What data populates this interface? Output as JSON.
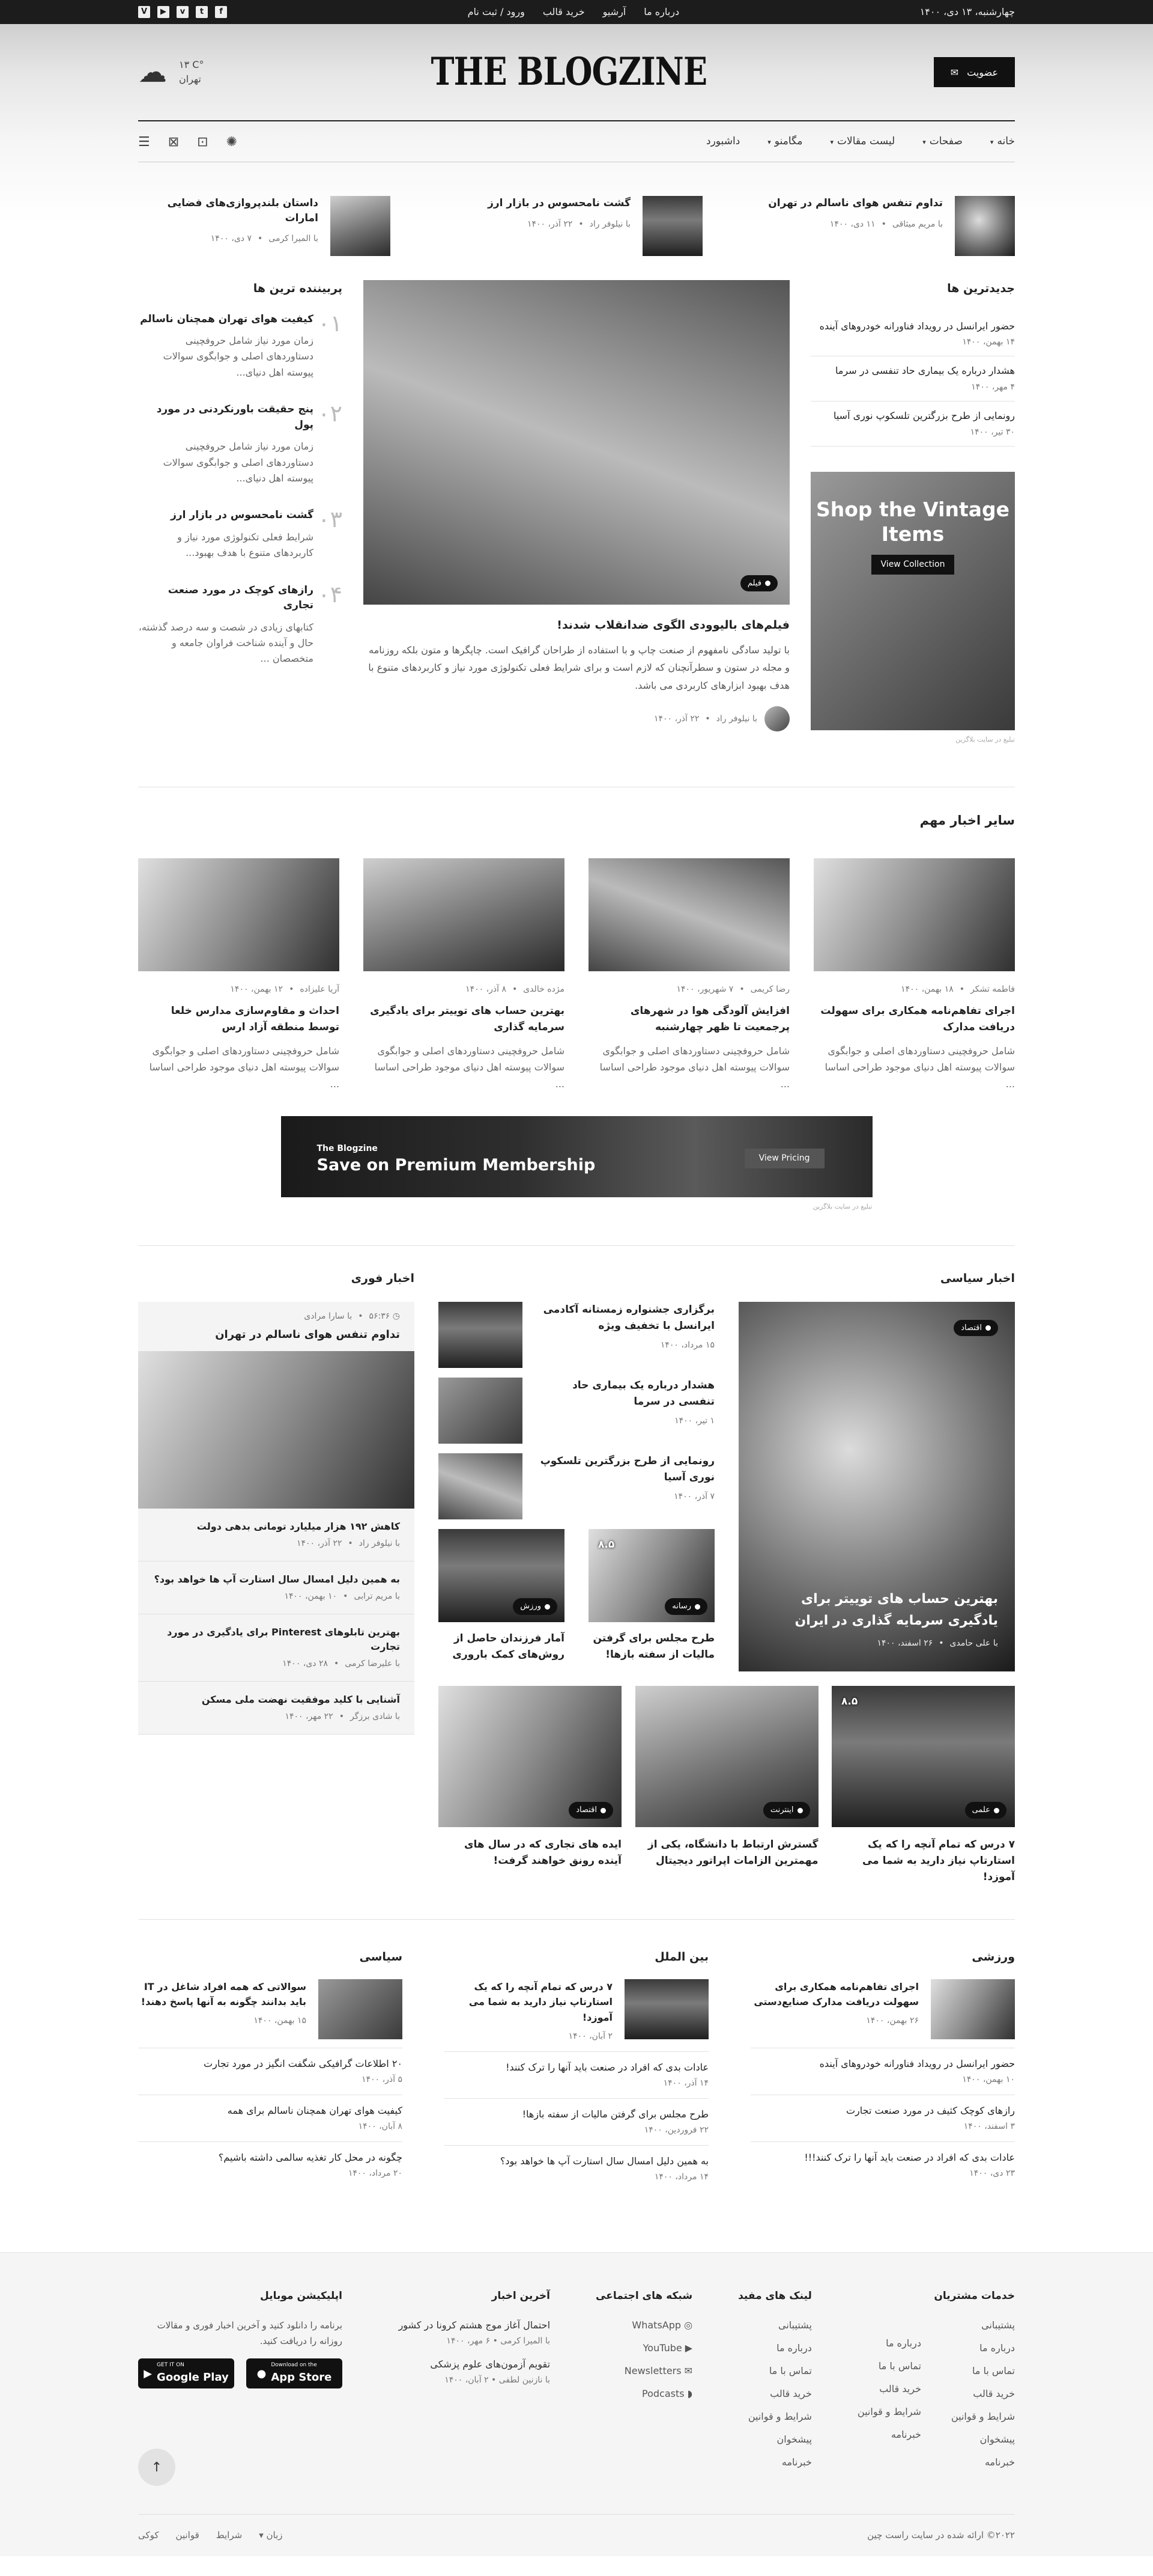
{
  "topbar": {
    "date": "چهارشنبه، ۱۳ دی، ۱۴۰۰",
    "links": [
      "درباره ما",
      "آرشیو",
      "خرید قالب",
      "ورود / ثبت نام"
    ],
    "social": [
      "facebook-icon",
      "twitter-icon",
      "vimeo-icon",
      "youtube-icon",
      "vine-icon"
    ]
  },
  "header": {
    "subscribe_label": "عضویت",
    "logo": "THE BLOGZINE",
    "weather_temp": "۱۳ C°",
    "weather_city": "تهران"
  },
  "nav": {
    "items": [
      "خانه",
      "صفحات",
      "لیست مقالات",
      "مگامنو",
      "داشبورد"
    ],
    "dropdown": [
      true,
      true,
      true,
      true,
      false
    ]
  },
  "top_row": [
    {
      "title": "تداوم تنفس هوای ناسالم در تهران",
      "author": "با مریم میثاقی",
      "date": "۱۱ دی، ۱۴۰۰"
    },
    {
      "title": "گشت نامحسوس در بازار ارز",
      "author": "با نیلوفر راد",
      "date": "۲۲ آذر، ۱۴۰۰"
    },
    {
      "title": "داستان بلندپروازی‌های فضایی امارات",
      "author": "با المیرا کرمی",
      "date": "۷ دی، ۱۴۰۰"
    }
  ],
  "latest": {
    "title": "جدیدترین ها",
    "items": [
      {
        "title": "حضور ایرانسل در رویداد فناورانه خودروهای آینده",
        "date": "۱۴ بهمن، ۱۴۰۰"
      },
      {
        "title": "هشدار درباره یک بیماری حاد تنفسی در سرما",
        "date": "۴ مهر، ۱۴۰۰"
      },
      {
        "title": "رونمایی از طرح بزرگترین تلسکوپ نوری آسیا",
        "date": "۳۰ تیر، ۱۴۰۰"
      }
    ]
  },
  "featured": {
    "badge": "فیلم",
    "title": "فیلم‌های بالیوودی الگوی ضدانقلاب شدند!",
    "excerpt": "با تولید سادگی نامفهوم از صنعت چاپ و با استفاده از طراحان گرافیک است. چاپگرها و متون بلکه روزنامه و مجله در ستون و سطرآنچنان که لازم است و برای شرایط فعلی تکنولوژی مورد نیاز و کاربردهای متنوع با هدف بهبود ابزارهای کاربردی می باشد.",
    "author": "با نیلوفر راد",
    "date": "۲۲ آذر، ۱۴۰۰"
  },
  "popular": {
    "title": "پربیننده ترین ها",
    "items": [
      {
        "num": "۰۱",
        "title": "کیفیت هوای تهران همچنان ناسالم",
        "text": "زمان مورد نیاز شامل حروفچینی دستاوردهای اصلی و جوابگوی سوالات پیوسته اهل دنیای..."
      },
      {
        "num": "۰۲",
        "title": "پنج حقیقت باورنکردنی در مورد پول",
        "text": "زمان مورد نیاز شامل حروفچینی دستاوردهای اصلی و جوابگوی سوالات پیوسته اهل دنیای..."
      },
      {
        "num": "۰۳",
        "title": "گشت نامحسوس در بازار ارز",
        "text": "شرایط فعلی تکنولوژی مورد نیاز و کاربردهای متنوع با هدف بهبود..."
      },
      {
        "num": "۰۴",
        "title": "رازهای کوچک در مورد صنعت تجاری",
        "text": "کتابهای زیادی در شصت و سه درصد گذشته، حال و آینده شناخت فراوان جامعه و متخصصان ..."
      }
    ]
  },
  "side_ad": {
    "title": "Shop the Vintage Items",
    "button": "View Collection",
    "note": "تبلیغ در سایت بلاگزین"
  },
  "other_news": {
    "title": "سایر اخبار مهم",
    "items": [
      {
        "author": "فاطمه تشکر",
        "date": "۱۸ بهمن، ۱۴۰۰",
        "title": "اجرای تفاهم‌نامه همکاری برای سهولت دریافت مدارک",
        "text": "شامل حروفچینی دستاوردهای اصلی و جوابگوی سوالات پیوسته اهل دنیای موجود طراحی اساسا ..."
      },
      {
        "author": "رضا کریمی",
        "date": "۷ شهریور، ۱۴۰۰",
        "title": "افزایش آلودگی هوا در شهرهای پرجمعیت تا ظهر چهارشنبه",
        "text": "شامل حروفچینی دستاوردهای اصلی و جوابگوی سوالات پیوسته اهل دنیای موجود طراحی اساسا ..."
      },
      {
        "author": "مژده خالدی",
        "date": "۸ آذر، ۱۴۰۰",
        "title": "بهترین حساب های توییتر برای یادگیری سرمایه گذاری",
        "text": "شامل حروفچینی دستاوردهای اصلی و جوابگوی سوالات پیوسته اهل دنیای موجود طراحی اساسا ..."
      },
      {
        "author": "آریا علیزاده",
        "date": "۱۲ بهمن، ۱۴۰۰",
        "title": "احداث و مقاوم‌سازی مدارس خلعا توسط منطقه آزاد ارس",
        "text": "شامل حروفچینی دستاوردهای اصلی و جوابگوی سوالات پیوسته اهل دنیای موجود طراحی اساسا ..."
      }
    ]
  },
  "banner": {
    "brand": "The Blogzine",
    "title": "Save on Premium Membership",
    "button": "View Pricing",
    "note": "تبلیغ در سایت بلاگزین"
  },
  "politics": {
    "title": "اخبار سیاسی",
    "main": {
      "badge": "اقتصاد",
      "title": "بهترین حساب های توییتر برای یادگیری سرمایه گذاری در ایران",
      "author": "با علی حامدی",
      "date": "۲۶ اسفند، ۱۴۰۰"
    },
    "list": [
      {
        "title": "برگزاری جشنواره زمستانه آکادمی ایرانسل با تخفیف ویژه",
        "date": "۱۵ مرداد، ۱۴۰۰"
      },
      {
        "title": "هشدار درباره یک بیماری حاد تنفسی در سرما",
        "date": "۱ تیر، ۱۴۰۰"
      },
      {
        "title": "رونمایی از طرح بزرگترین تلسکوپ نوری آسیا",
        "date": "۷ آذر، ۱۴۰۰"
      }
    ],
    "two": [
      {
        "badge": "رسانه",
        "score": "۸.۵",
        "title": "طرح مجلس برای گرفتن مالیات از سفته بازها!"
      },
      {
        "badge": "ورزش",
        "score": "",
        "title": "آمار فرزندان حاصل از روش‌های کمک باروری"
      }
    ],
    "three": [
      {
        "badge": "علمی",
        "score": "۸.۵",
        "title": "۷ درس که تمام آنچه را که یک استارتاپ نیاز دارید به شما می آموزد!"
      },
      {
        "badge": "اینترنت",
        "score": "",
        "title": "گسترش ارتباط با دانشگاه، یکی از مهمترین الزامات اپراتور دیجیتال"
      },
      {
        "badge": "اقتصاد",
        "score": "",
        "title": "ایده های تجاری که در سال های آینده رونق خواهند گرفت!"
      }
    ]
  },
  "breaking": {
    "title": "اخبار فوری",
    "top": {
      "time": "۵۶:۳۶",
      "author": "با سارا مرادی",
      "title": "تداوم تنفس هوای ناسالم در تهران"
    },
    "items": [
      {
        "title": "کاهش ۱۹۲ هزار میلیارد تومانی بدهی دولت",
        "author": "با نیلوفر راد",
        "date": "۲۲ آذر، ۱۴۰۰"
      },
      {
        "title": "به همین دلیل امسال سال استارت آپ ها خواهد بود؟",
        "author": "با مریم ترابی",
        "date": "۱۰ بهمن، ۱۴۰۰"
      },
      {
        "title": "بهترین تابلوهای Pinterest برای یادگیری در مورد تجارت",
        "author": "با علیرضا کرمی",
        "date": "۲۸ دی، ۱۴۰۰"
      },
      {
        "title": "آشنایی با کلید موفقیت نهضت ملی مسکن",
        "author": "با شادی برزگر",
        "date": "۲۲ مهر، ۱۴۰۰"
      }
    ]
  },
  "categories": [
    {
      "title": "ورزشی",
      "feat_title": "اجرای تفاهم‌نامه همکاری برای سهولت دریافت مدارک صنایع‌دستی",
      "feat_date": "۲۶ بهمن، ۱۴۰۰",
      "items": [
        {
          "title": "حضور ایرانسل در رویداد فناورانه خودروهای آینده",
          "date": "۱۰ بهمن، ۱۴۰۰"
        },
        {
          "title": "رازهای کوچک کثیف در مورد صنعت تجارت",
          "date": "۳ اسفند، ۱۴۰۰"
        },
        {
          "title": "عادات بدی که افراد در صنعت باید آنها را ترک کنند!!!",
          "date": "۲۳ دی، ۱۴۰۰"
        }
      ]
    },
    {
      "title": "بین الملل",
      "feat_title": "۷ درس که تمام آنچه را که یک استارتاپ نیاز دارید به شما می آموزد!",
      "feat_date": "۲ آبان، ۱۴۰۰",
      "items": [
        {
          "title": "عادات بدی که افراد در صنعت باید آنها را ترک کنند!",
          "date": "۱۴ آذر، ۱۴۰۰"
        },
        {
          "title": "طرح مجلس برای گرفتن مالیات از سفته بازها!",
          "date": "۲۲ فروردین، ۱۴۰۰"
        },
        {
          "title": "به همین دلیل امسال سال استارت آپ ها خواهد بود؟",
          "date": "۱۴ مرداد، ۱۴۰۰"
        }
      ]
    },
    {
      "title": "سیاسی",
      "feat_title": "سوالاتی که همه افراد شاغل در IT باید بدانند چگونه به آنها پاسخ دهند!",
      "feat_date": "۱۵ بهمن، ۱۴۰۰",
      "items": [
        {
          "title": "۲۰ اطلاعات گرافیکی شگفت انگیز در مورد تجارت",
          "date": "۵ آذر، ۱۴۰۰"
        },
        {
          "title": "کیفیت هوای تهران همچنان ناسالم برای همه",
          "date": "۸ آبان، ۱۴۰۰"
        },
        {
          "title": "چگونه در محل کار تغذیه سالمی داشته باشیم؟",
          "date": "۲۰ مرداد، ۱۴۰۰"
        }
      ]
    }
  ],
  "footer": {
    "services_title": "خدمات مشتریان",
    "services_a": [
      "پشتیبانی",
      "درباره ما",
      "تماس با ما",
      "خرید قالب",
      "شرایط و قوانین",
      "پیشخوان",
      "خبرنامه"
    ],
    "services_b": [
      "درباره ما",
      "تماس با ما",
      "خرید قالب",
      "شرایط و قوانین",
      "خبرنامه"
    ],
    "links_title": "لینک های مفید",
    "links": [
      "پشتیبانی",
      "درباره ما",
      "تماس با ما",
      "خرید قالب",
      "شرایط و قوانین",
      "پیشخوان",
      "خبرنامه"
    ],
    "social_title": "شبکه های اجتماعی",
    "social": [
      "WhatsApp",
      "YouTube",
      "Newsletters",
      "Podcasts"
    ],
    "news_title": "آخرین اخبار",
    "news": [
      {
        "title": "احتمال آغاز موج هشتم کرونا در کشور",
        "meta": "با المیرا کرمی • ۶ مهر، ۱۴۰۰"
      },
      {
        "title": "تقویم آزمون‌های علوم پزشکی",
        "meta": "با نازنین لطفی • ۲ آبان، ۱۴۰۰"
      }
    ],
    "app_title": "اپلیکیشن موبایل",
    "app_text": "برنامه را دانلود کنید و آخرین اخبار فوری و مقالات روزانه را دریافت کنید.",
    "stores": [
      {
        "small": "Download on the",
        "big": "App Store"
      },
      {
        "small": "GET IT ON",
        "big": "Google Play"
      }
    ],
    "copyright": "۲۰۲۲© ارائه شده در سایت راست چین",
    "bottom_links": [
      "زبان",
      "شرایط",
      "قوانین",
      "کوکی"
    ]
  }
}
